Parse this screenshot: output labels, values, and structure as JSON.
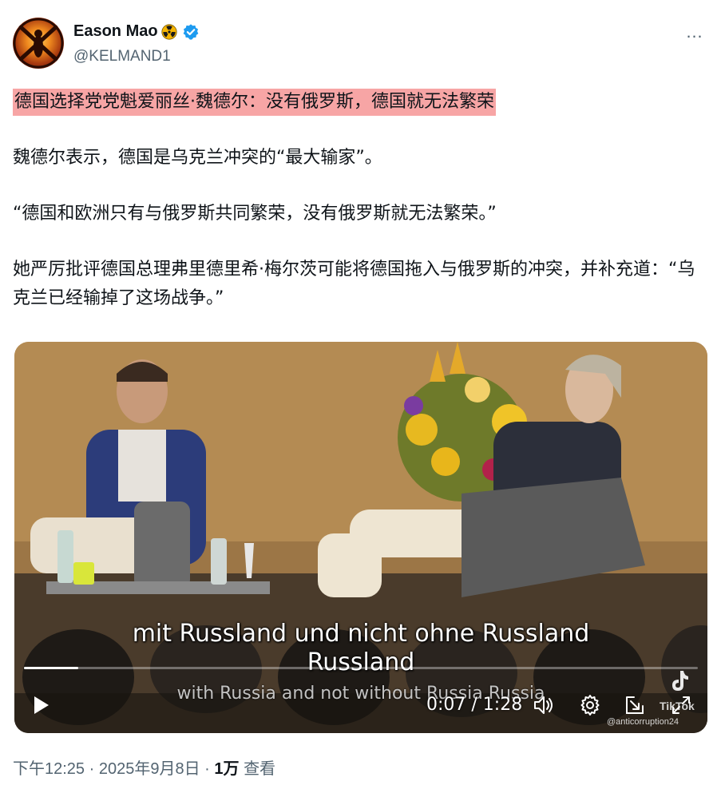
{
  "author": {
    "display_name": "Eason Mao",
    "handle": "@KELMAND1",
    "badge_icon": "radioactive-icon",
    "verified_icon": "verified-badge-icon",
    "verified_color": "#1d9bf0"
  },
  "more_icon": "…",
  "post": {
    "headline": "德国选择党党魁爱丽丝·魏德尔：没有俄罗斯，德国就无法繁荣",
    "headline_highlight_color": "#f7a5a5",
    "paragraph_1": "魏德尔表示，德国是乌克兰冲突的“最大输家”。",
    "paragraph_2": "“德国和欧洲只有与俄罗斯共同繁荣，没有俄罗斯就无法繁荣。”",
    "paragraph_3": "她严厉批评德国总理弗里德里希·梅尔茨可能将德国拖入与俄罗斯的冲突，并补充道：“乌克兰已经输掉了这场战争。”"
  },
  "video": {
    "subtitle_de_line1": "mit Russland und nicht ohne Russland",
    "subtitle_de_line2": "Russland",
    "subtitle_en": "with Russia and not without Russia Russia",
    "current_time": "0:07",
    "duration": "1:28",
    "time_display": "0:07 / 1:28",
    "progress_fraction": 0.08,
    "watermark_label": "TikTok",
    "watermark_handle": "@anticorruption24",
    "controls": {
      "play": "play-icon",
      "volume": "volume-icon",
      "settings": "gear-icon",
      "pip": "picture-in-picture-icon",
      "fullscreen": "fullscreen-icon"
    }
  },
  "meta": {
    "time": "下午12:25",
    "date": "2025年9月8日",
    "views_count": "1万",
    "views_label": "查看"
  }
}
